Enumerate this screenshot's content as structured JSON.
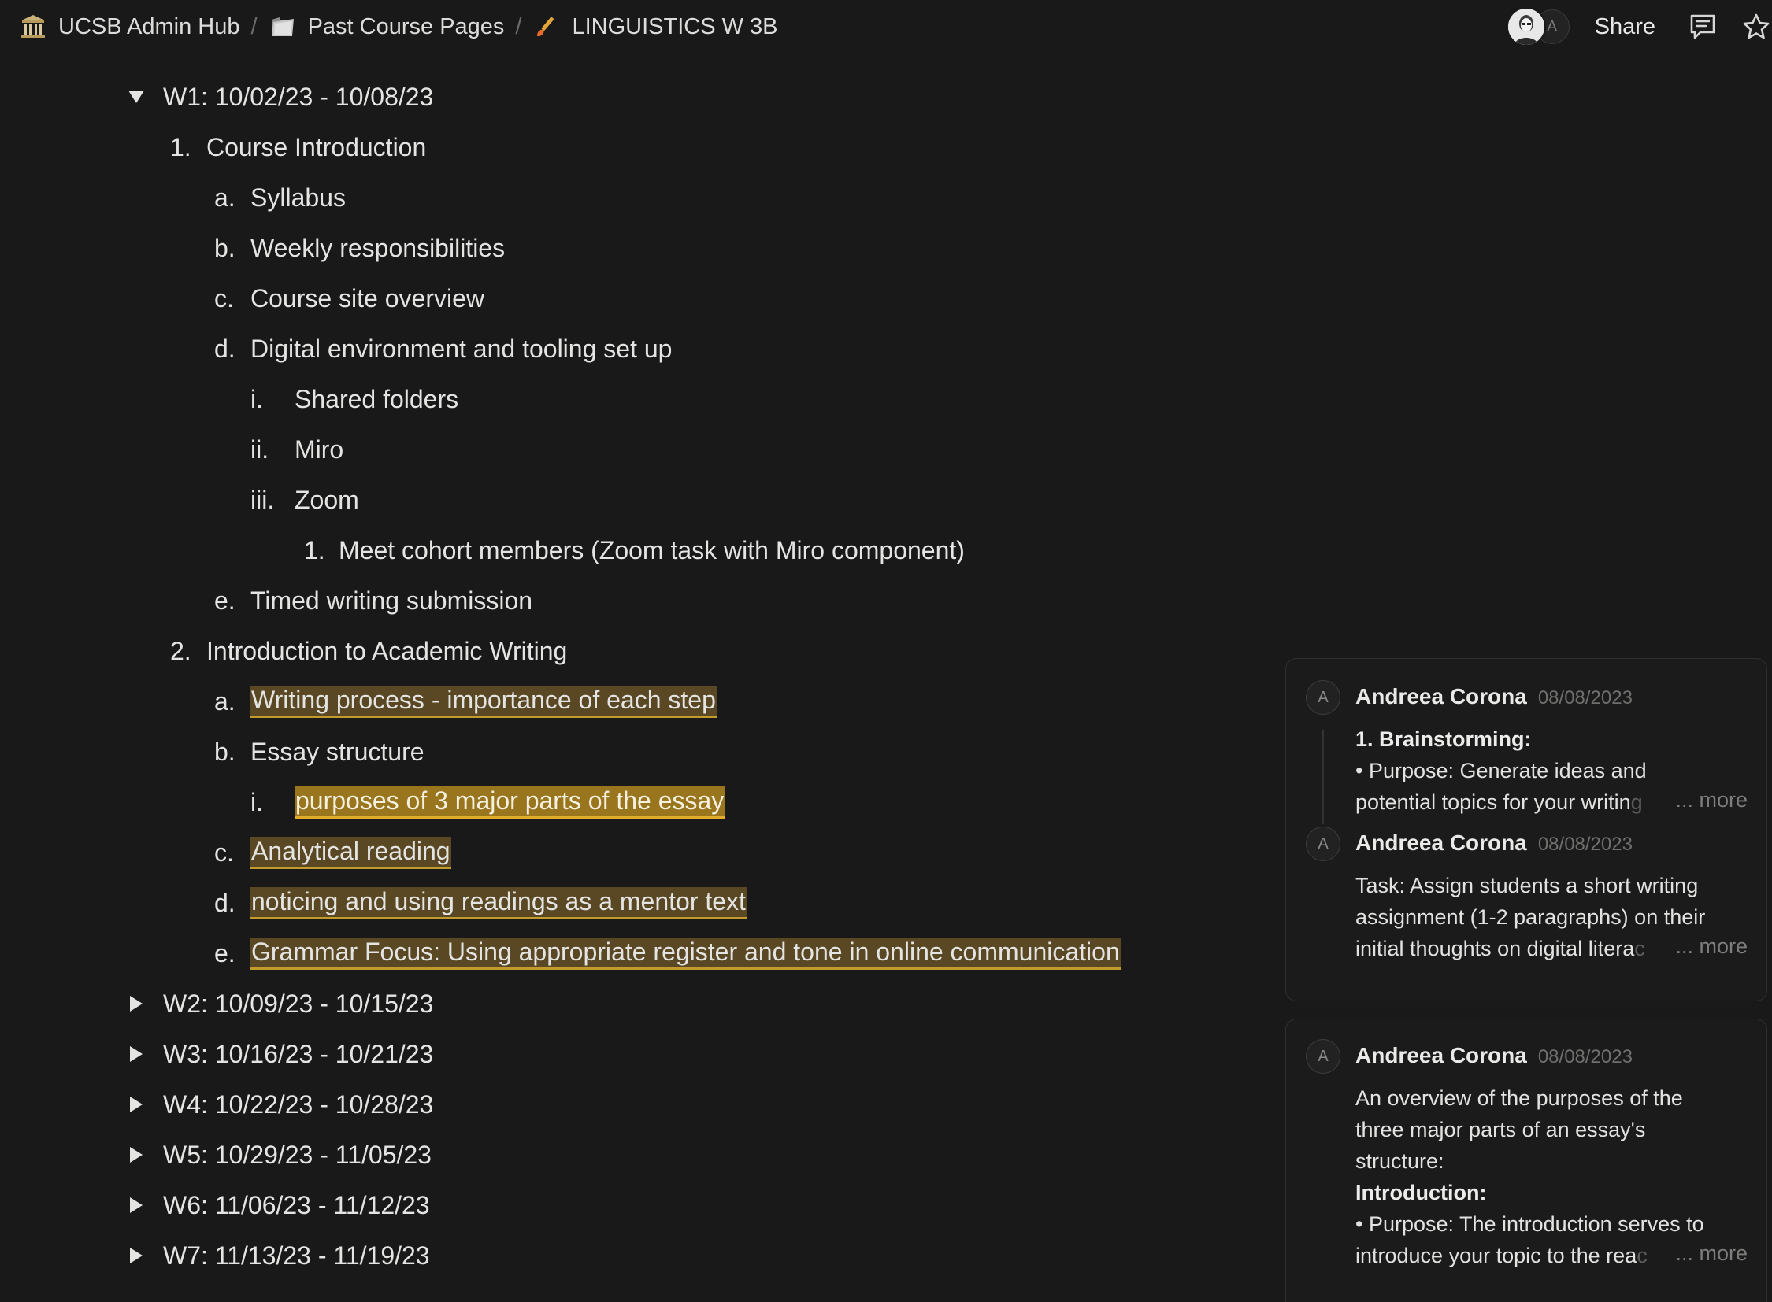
{
  "breadcrumb": {
    "items": [
      {
        "label": "UCSB Admin Hub",
        "icon": "classical-building-icon"
      },
      {
        "label": "Past Course Pages",
        "icon": "folder-icon"
      },
      {
        "label": "LINGUISTICS W 3B",
        "icon": "paintbrush-icon"
      }
    ],
    "separator": "/"
  },
  "topbar": {
    "avatar_letter": "A",
    "share_label": "Share",
    "comments_icon": "comment-icon",
    "favorite_icon": "star-icon"
  },
  "outline": {
    "w1": {
      "title": "W1: 10/02/23 - 10/08/23",
      "items": [
        {
          "marker": "1.",
          "label": "Course Introduction"
        },
        {
          "marker": "a.",
          "label": "Syllabus"
        },
        {
          "marker": "b.",
          "label": "Weekly responsibilities"
        },
        {
          "marker": "c.",
          "label": "Course site overview"
        },
        {
          "marker": "d.",
          "label": "Digital environment and tooling set up"
        },
        {
          "marker": "i.",
          "label": "Shared folders"
        },
        {
          "marker": "ii.",
          "label": "Miro"
        },
        {
          "marker": "iii.",
          "label": "Zoom"
        },
        {
          "marker": "1.",
          "label": "Meet cohort members (Zoom task with Miro component)"
        },
        {
          "marker": "e.",
          "label": "Timed writing submission"
        },
        {
          "marker": "2.",
          "label": "Introduction to Academic Writing"
        },
        {
          "marker": "a.",
          "label": "Writing process - importance of each step"
        },
        {
          "marker": "b.",
          "label": "Essay structure"
        },
        {
          "marker": "i.",
          "label": "purposes of 3 major parts of the essay"
        },
        {
          "marker": "c.",
          "label": "Analytical reading"
        },
        {
          "marker": "d.",
          "label": "noticing and using readings as a mentor text"
        },
        {
          "marker": "e.",
          "label": "Grammar Focus: Using appropriate register and tone in online communication"
        }
      ]
    },
    "collapsed_weeks": [
      "W2: 10/09/23 - 10/15/23",
      "W3: 10/16/23 - 10/21/23",
      "W4: 10/22/23 - 10/28/23",
      "W5: 10/29/23 - 11/05/23",
      "W6: 11/06/23 - 11/12/23",
      "W7: 11/13/23 - 11/19/23"
    ]
  },
  "comments": {
    "more_label": "... more",
    "thread1": [
      {
        "avatar": "A",
        "author": "Andreea Corona",
        "date": "08/08/2023",
        "heading": "1. Brainstorming:",
        "line1": "• Purpose: Generate ideas and",
        "line2_visible": "potential topics for your writin",
        "line2_faded": "g"
      },
      {
        "avatar": "A",
        "author": "Andreea Corona",
        "date": "08/08/2023",
        "line1": "Task: Assign students a short writing",
        "line2": "assignment (1-2 paragraphs) on their",
        "line3_visible": "initial thoughts on digital litera",
        "line3_faded": "c"
      }
    ],
    "thread2": [
      {
        "avatar": "A",
        "author": "Andreea Corona",
        "date": "08/08/2023",
        "line1": "An overview of the purposes of the",
        "line2": "three major parts of an essay's",
        "line3": "structure:",
        "heading": "Introduction:",
        "line4": "• Purpose: The introduction serves to",
        "line5_visible": "introduce your topic to the rea",
        "line5_faded": "c"
      }
    ]
  },
  "colors": {
    "background": "#191919",
    "highlight": "#8e702b",
    "highlight_strong": "#b08620",
    "underline": "#c39a2c"
  }
}
